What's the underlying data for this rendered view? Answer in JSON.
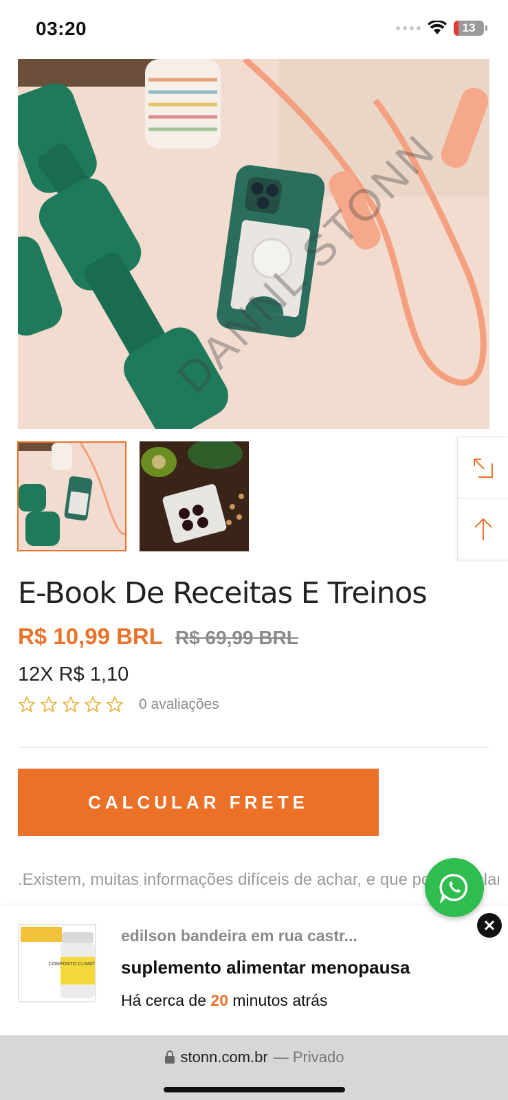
{
  "status_bar": {
    "time": "03:20",
    "battery": "13",
    "icons": [
      "signal-icon",
      "wifi-icon",
      "battery-icon"
    ]
  },
  "gallery": {
    "watermark": "DANNL STONN",
    "thumbnails": [
      "thumbnail-fitness",
      "thumbnail-food"
    ],
    "selected_index": 0,
    "side_actions": [
      "expand-icon",
      "arrow-up-icon"
    ]
  },
  "product": {
    "title": "E-Book De Receitas E Treinos",
    "price_current": "R$ 10,99 BRL",
    "price_old": "R$ 69,99 BRL",
    "installments": "12X R$ 1,10",
    "rating": 0,
    "rating_max": 5,
    "reviews": "0 avaliações",
    "cta_label": "CALCULAR FRETE",
    "description": ".Existem, muitas informações difíceis de achar, e que poucos falam, mas que decidi trazer em primeira mão"
  },
  "notification": {
    "meta": "edilson bandeira em rua castr...",
    "product": "suplemento alimentar menopausa",
    "time_prefix": "Há cerca de ",
    "time_value": "20",
    "time_suffix": " minutos atrás",
    "image_caption": "COMPOSTO CLIMATÉRIO"
  },
  "browser": {
    "domain": "stonn.com.br",
    "privacy": "— Privado"
  },
  "colors": {
    "accent": "#e9732a",
    "whatsapp": "#2ebd4e"
  }
}
